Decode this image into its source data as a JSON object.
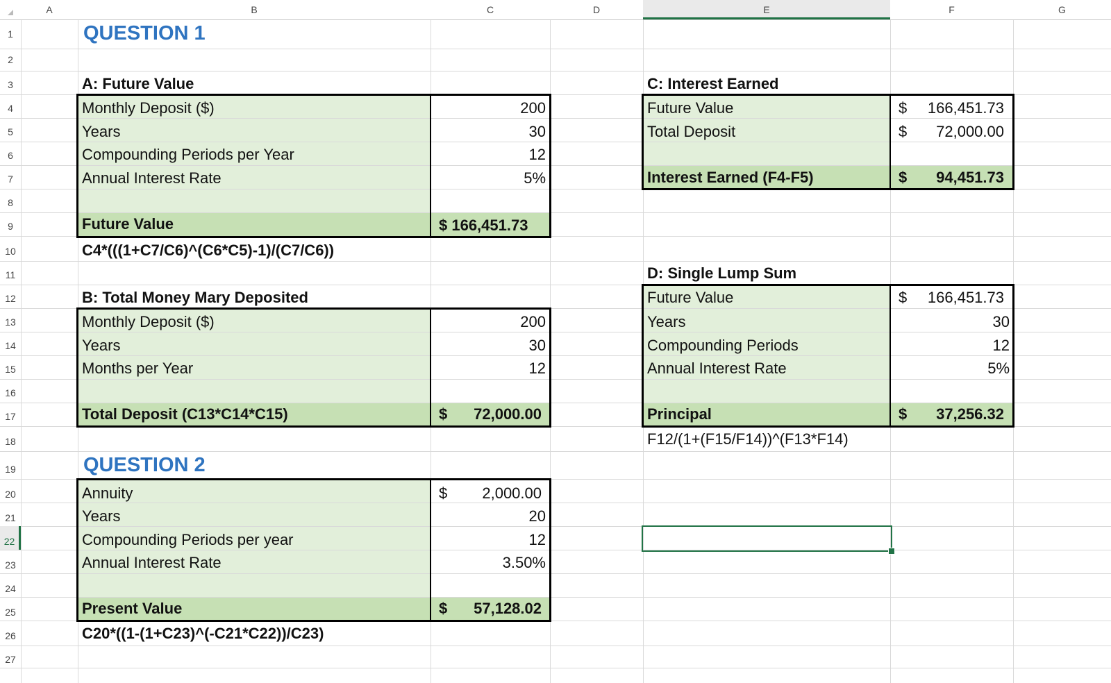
{
  "columns": [
    "A",
    "B",
    "C",
    "D",
    "E",
    "F",
    "G"
  ],
  "rows": [
    "1",
    "2",
    "3",
    "4",
    "5",
    "6",
    "7",
    "8",
    "9",
    "10",
    "11",
    "12",
    "13",
    "14",
    "15",
    "16",
    "17",
    "18",
    "19",
    "20",
    "21",
    "22",
    "23",
    "24",
    "25",
    "26",
    "27"
  ],
  "question1": {
    "title": "QUESTION 1",
    "partA": {
      "heading": "A: Future Value",
      "rows": [
        {
          "label": "Monthly Deposit ($)",
          "value": "200"
        },
        {
          "label": "Years",
          "value": "30"
        },
        {
          "label": "Compounding Periods per Year",
          "value": "12"
        },
        {
          "label": "Annual Interest Rate",
          "value": "5%"
        }
      ],
      "result_label": "Future Value",
      "result_value": "$ 166,451.73",
      "formula": "C4*(((1+C7/C6)^(C6*C5)-1)/(C7/C6))"
    },
    "partB": {
      "heading": "B: Total Money Mary Deposited",
      "rows": [
        {
          "label": "Monthly Deposit ($)",
          "value": "200"
        },
        {
          "label": "Years",
          "value": "30"
        },
        {
          "label": "Months per Year",
          "value": "12"
        }
      ],
      "result_label": "Total Deposit (C13*C14*C15)",
      "result_currency": "$",
      "result_value": "72,000.00"
    },
    "partC": {
      "heading": "C: Interest Earned",
      "rows": [
        {
          "label": "Future Value",
          "currency": "$",
          "value": "166,451.73"
        },
        {
          "label": "Total Deposit",
          "currency": "$",
          "value": "72,000.00"
        }
      ],
      "result_label": "Interest Earned (F4-F5)",
      "result_currency": "$",
      "result_value": "94,451.73"
    },
    "partD": {
      "heading": "D: Single Lump Sum",
      "first_label": "Future Value",
      "first_currency": "$",
      "first_value": "166,451.73",
      "rows": [
        {
          "label": "Years",
          "value": "30"
        },
        {
          "label": "Compounding Periods",
          "value": "12"
        },
        {
          "label": "Annual Interest Rate",
          "value": "5%"
        }
      ],
      "result_label": "Principal",
      "result_currency": "$",
      "result_value": "37,256.32",
      "formula": "F12/(1+(F15/F14))^(F13*F14)"
    }
  },
  "question2": {
    "title": "QUESTION 2",
    "first_label": "Annuity",
    "first_currency": "$",
    "first_value": "2,000.00",
    "rows": [
      {
        "label": "Years",
        "value": "20"
      },
      {
        "label": "Compounding Periods per year",
        "value": "12"
      },
      {
        "label": "Annual Interest Rate",
        "value": "3.50%"
      }
    ],
    "result_label": "Present Value",
    "result_currency": "$",
    "result_value": "57,128.02",
    "formula": "C20*((1-(1+C23)^(-C21*C22))/C23)"
  },
  "selection": {
    "cell": "E22"
  }
}
